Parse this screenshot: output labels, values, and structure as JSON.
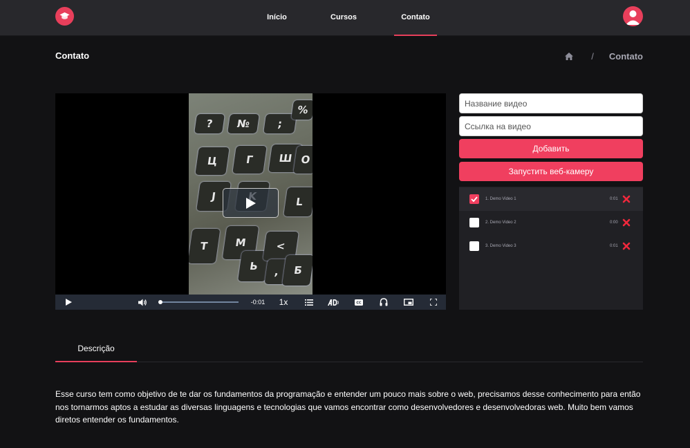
{
  "header": {
    "nav": [
      {
        "label": "Início",
        "active": false
      },
      {
        "label": "Cursos",
        "active": false
      },
      {
        "label": "Contato",
        "active": true
      }
    ]
  },
  "breadcrumb": {
    "page_title": "Contato",
    "separator": "/",
    "current": "Contato"
  },
  "video": {
    "time_remaining": "-0:01",
    "playback_rate": "1x",
    "progress": 0.0,
    "keyboard_keys": [
      "?",
      "№",
      ";",
      "%",
      "Ц",
      "Г",
      "Ш",
      "О",
      "J",
      "K",
      "L",
      "Т",
      "М",
      "Ь",
      "<",
      ",",
      "Б"
    ]
  },
  "side_panel": {
    "video_name_placeholder": "Название видео",
    "video_link_placeholder": "Ссылка на видео",
    "add_button": "Добавить",
    "webcam_button": "Запустить веб-камеру",
    "playlist": [
      {
        "title": "1. Demo Video 1",
        "duration": "0:01",
        "checked": true
      },
      {
        "title": "2. Demo Video 2",
        "duration": "0:00",
        "checked": false
      },
      {
        "title": "3. Demo Video 3",
        "duration": "0:01",
        "checked": false
      }
    ]
  },
  "tabs": {
    "description_label": "Descrição"
  },
  "description": "Esse curso tem como objetivo de te dar os fundamentos da programação e entender um pouco mais sobre o web, precisamos desse conhecimento para então nos tornarmos aptos a estudar as diversas linguagens e tecnologias que vamos encontrar como desenvolvedores e desenvolvedoras web. Muito bem vamos diretos entender os fundamentos.",
  "colors": {
    "accent": "#e83f5b",
    "button": "#f03f5f",
    "background": "#121214",
    "header": "#28282c",
    "panel": "#202024"
  },
  "icons": {
    "logo": "graduation-cap-icon",
    "breadcrumb_home": "home-icon",
    "avatar": "user-icon",
    "delete": "close-x-icon"
  }
}
